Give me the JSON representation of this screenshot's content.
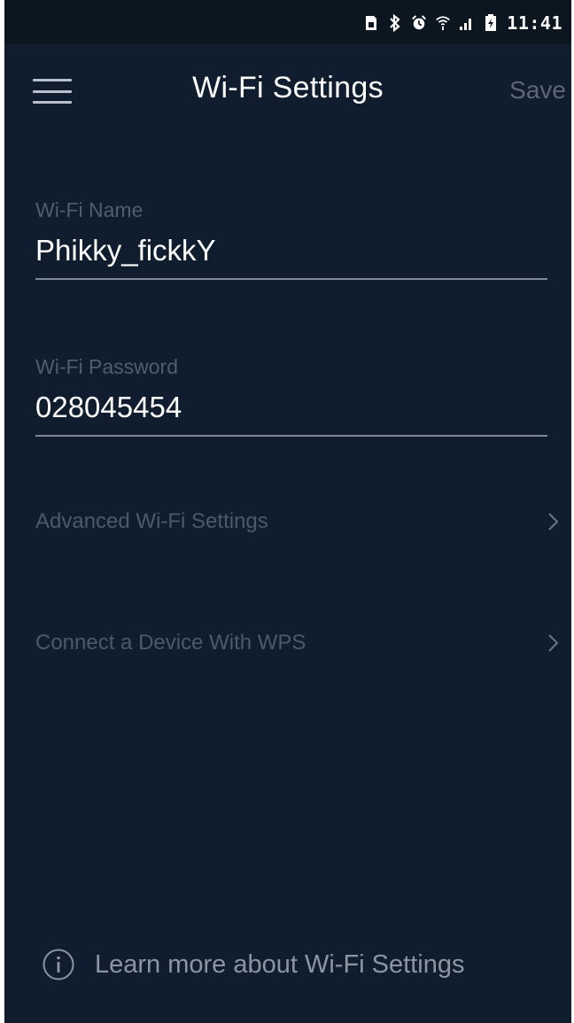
{
  "status_bar": {
    "time": "11:41",
    "icons": [
      "sim-card-icon",
      "bluetooth-icon",
      "alarm-icon",
      "wifi-icon",
      "signal-icon",
      "battery-icon"
    ]
  },
  "header": {
    "title": "Wi-Fi Settings",
    "save_label": "Save",
    "menu_icon": "hamburger-menu-icon"
  },
  "form": {
    "wifi_name": {
      "label": "Wi-Fi Name",
      "value": "Phikky_fickkY"
    },
    "wifi_password": {
      "label": "Wi-Fi Password",
      "value": "028045454"
    }
  },
  "rows": [
    {
      "label": "Advanced Wi-Fi Settings",
      "icon": "chevron-right-icon"
    },
    {
      "label": "Connect a Device With WPS",
      "icon": "chevron-right-icon"
    }
  ],
  "footer": {
    "learn_more": "Learn more about Wi-Fi Settings",
    "icon": "info-icon"
  },
  "colors": {
    "background": "#0f1d2e",
    "status_bar": "#0b1621",
    "text_primary": "#ffffff",
    "text_muted": "#525d6b",
    "save_disabled": "#5d6672"
  }
}
